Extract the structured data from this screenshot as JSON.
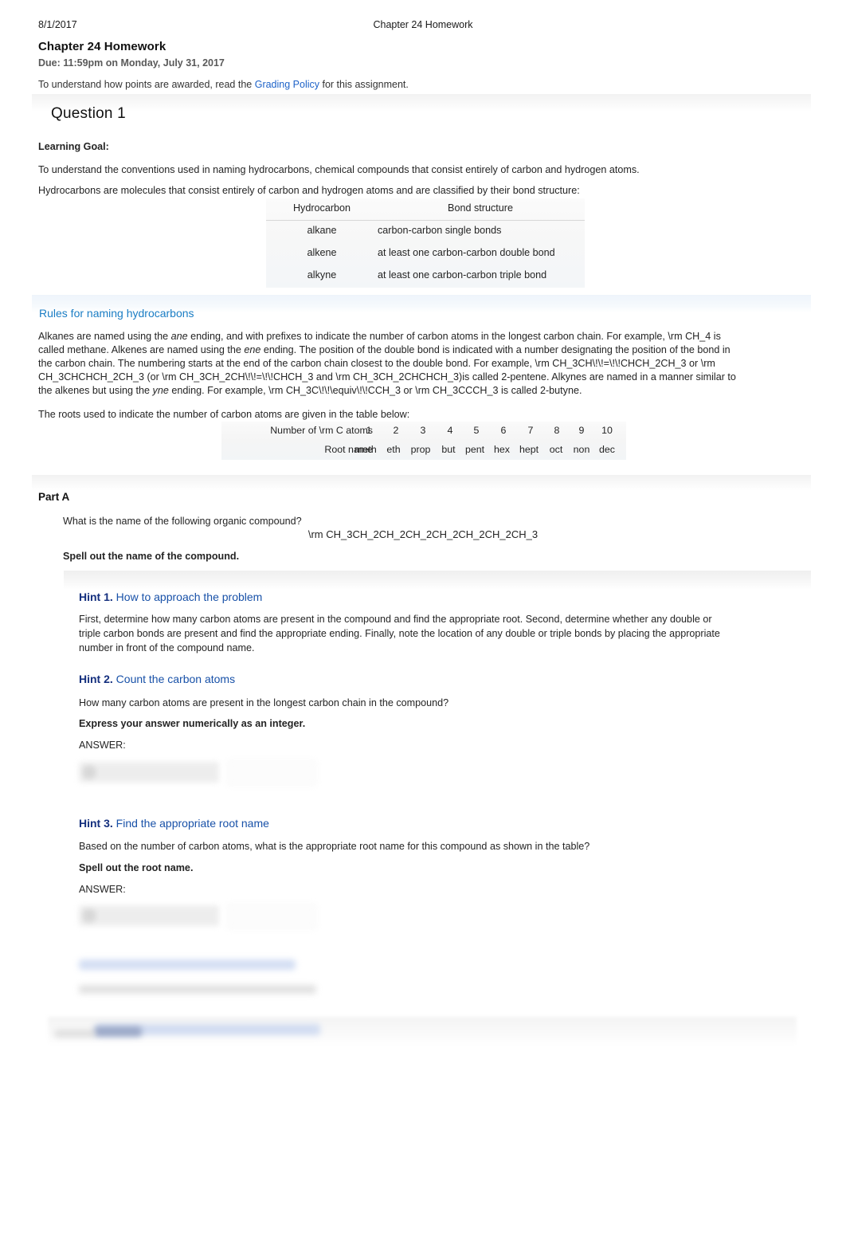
{
  "print_header": {
    "date": "8/1/2017",
    "title": "Chapter 24 Homework"
  },
  "assignment": {
    "title": "Chapter 24 Homework",
    "due": "Due: 11:59pm on Monday, July 31, 2017",
    "policy_prefix": "To understand how points are awarded, read the ",
    "policy_link": "Grading Policy",
    "policy_suffix": " for this assignment."
  },
  "question": {
    "title": "Question 1",
    "learning_goal_label": "Learning Goal:",
    "learning_goal_text": "To understand the conventions used in naming hydrocarbons, chemical compounds that consist entirely of carbon and hydrogen atoms.",
    "intro_text": "Hydrocarbons are molecules that consist entirely of carbon and hydrogen atoms and are classified by their bond structure:"
  },
  "hydrocarbon_table": {
    "headers": [
      "Hydrocarbon",
      "Bond structure"
    ],
    "rows": [
      [
        "alkane",
        "carbon-carbon single bonds"
      ],
      [
        "alkene",
        "at least one carbon-carbon double bond"
      ],
      [
        "alkyne",
        "at least one carbon-carbon triple bond"
      ]
    ]
  },
  "rules": {
    "heading": "Rules for naming hydrocarbons",
    "line1_a": "Alkanes are named using the ",
    "line1_ital": "ane",
    "line1_b": " ending, and with prefixes to indicate the number of carbon atoms in the longest carbon chain. For example, \\rm CH_4 is",
    "line2_a": "called methane. Alkenes are named using the ",
    "line2_ital": "ene",
    "line2_b": " ending. The position of the double bond is indicated with a number designating the position of the bond in",
    "line3": "the carbon chain. The numbering starts at the end of the carbon chain closest to the double bond. For example, \\rm CH_3CH\\!\\!=\\!\\!CHCH_2CH_3 or \\rm",
    "line4": "CH_3CHCHCH_2CH_3 (or \\rm CH_3CH_2CH\\!\\!=\\!\\!CHCH_3 and \\rm CH_3CH_2CHCHCH_3)is called 2-pentene. Alkynes are named in a manner similar to",
    "line5_a": "the alkenes but using the ",
    "line5_ital": "yne",
    "line5_b": " ending. For example, \\rm CH_3C\\!\\!\\equiv\\!\\!CCH_3 or \\rm CH_3CCCH_3 is called 2-butyne.",
    "roots_intro": "The roots used to indicate the number of carbon atoms are given in the table below:"
  },
  "roots_table": {
    "row1_label": "Number of \\rm C  atoms",
    "row2_label": "Root name",
    "counts": [
      "1",
      "2",
      "3",
      "4",
      "5",
      "6",
      "7",
      "8",
      "9",
      "10"
    ],
    "roots": [
      "meth",
      "eth",
      "prop",
      "but",
      "pent",
      "hex",
      "hept",
      "oct",
      "non",
      "dec"
    ]
  },
  "part_a": {
    "title": "Part A",
    "question": "What is the name of the following organic compound?",
    "formula": "\\rm CH_3CH_2CH_2CH_2CH_2CH_2CH_2CH_3",
    "instruction": "Spell out the name of the compound."
  },
  "hints": [
    {
      "number": "Hint 1.",
      "title": "How to approach the problem",
      "body_line1": "First, determine how many carbon atoms are present in the compound and find the appropriate root. Second, determine whether any double or",
      "body_line2": "triple carbon bonds are present and find the appropriate ending. Finally, note the location of any double or triple bonds by placing the appropriate",
      "body_line3": "number in front of the compound name."
    },
    {
      "number": "Hint 2.",
      "title": "Count the carbon atoms",
      "body_line1": "How many carbon atoms are present in the longest carbon chain in the compound?",
      "instruction": "Express your answer numerically as an integer.",
      "answer_label": "ANSWER:"
    },
    {
      "number": "Hint 3.",
      "title": "Find the appropriate root name",
      "body_line1": "Based on the number of carbon atoms, what is the appropriate root name for this compound as shown in the table?",
      "instruction": "Spell out the root name.",
      "answer_label": "ANSWER:"
    }
  ],
  "colors": {
    "link_blue": "#1d62c8",
    "rules_heading_blue": "#1a7dc4",
    "hint_title_blue": "#1851a8",
    "hint_number_blue": "#142f7e",
    "body_text": "#242424",
    "muted_text": "#5a5a5a"
  }
}
